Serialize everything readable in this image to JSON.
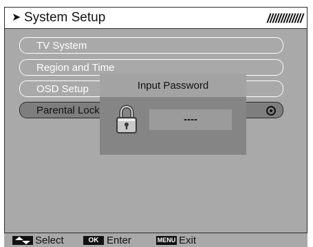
{
  "header": {
    "arrow_glyph": "➤",
    "title": "System Setup",
    "stripes": "/////////////"
  },
  "menu": {
    "items": [
      {
        "label": "TV System"
      },
      {
        "label": "Region and Time"
      },
      {
        "label": "OSD Setup"
      },
      {
        "label": "Parental Lock"
      }
    ],
    "selected_index": 3
  },
  "dialog": {
    "title": "Input Password",
    "password_value": "----",
    "icon": "lock-icon"
  },
  "footer": {
    "select_key_icon": "up-down-arrows-icon",
    "select_label": "Select",
    "ok_key": "OK",
    "enter_label": "Enter",
    "menu_key": "MENU",
    "exit_label": "Exit"
  },
  "colors": {
    "panel": "#a9a9a9",
    "selected_item": "#7e7e7e",
    "dialog_body": "#858585",
    "dialog_header": "#a3a3a3",
    "text_light": "#ffffff",
    "text_dark": "#111111"
  }
}
